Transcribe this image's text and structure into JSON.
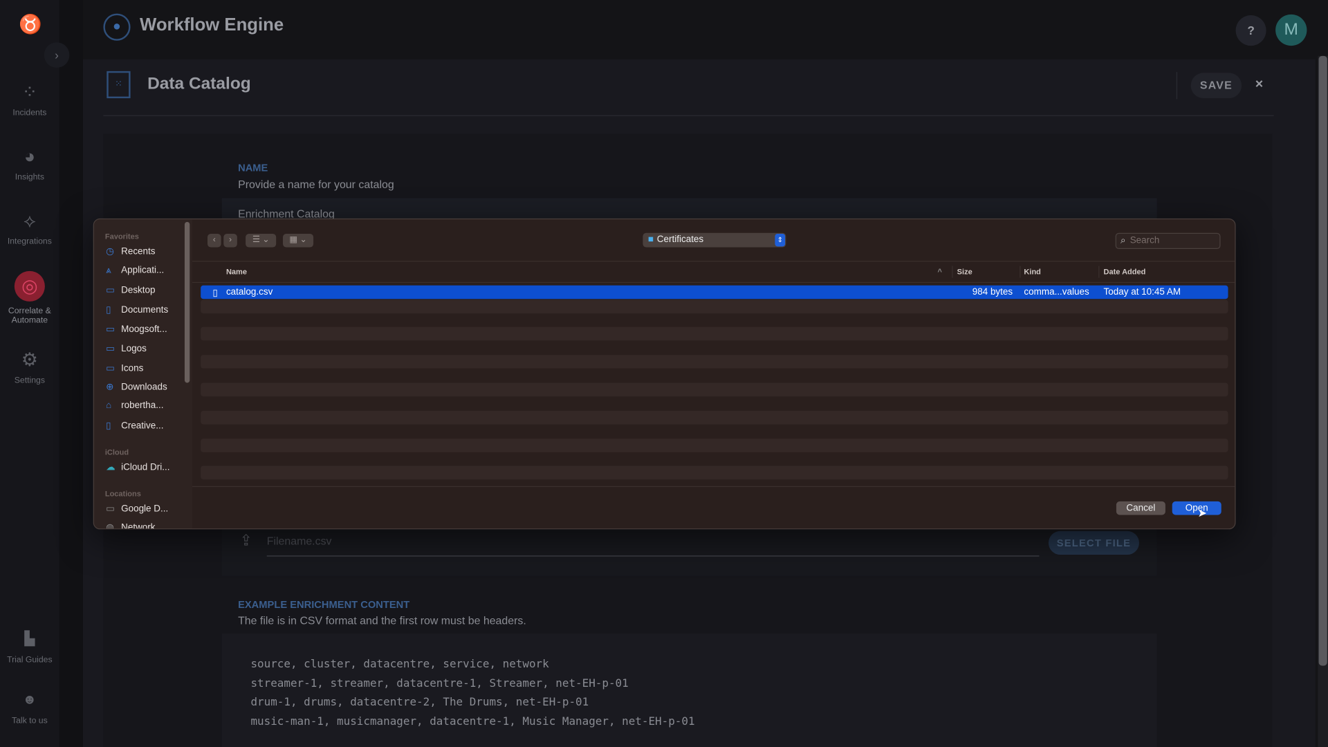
{
  "app": {
    "title": "Workflow Engine",
    "help_label": "?",
    "avatar_initial": "M"
  },
  "nav": {
    "items": [
      {
        "label": "Incidents",
        "icon": "incidents-icon"
      },
      {
        "label": "Insights",
        "icon": "pie-chart-icon"
      },
      {
        "label": "Integrations",
        "icon": "integrations-icon"
      },
      {
        "label": "Correlate & Automate",
        "icon": "radar-icon",
        "active": true
      },
      {
        "label": "Settings",
        "icon": "gear-icon"
      },
      {
        "label": "Trial Guides",
        "icon": "book-icon"
      },
      {
        "label": "Talk to us",
        "icon": "support-icon"
      }
    ],
    "accent": "#c0283a"
  },
  "page": {
    "title": "Data Catalog",
    "save_label": "SAVE",
    "close_label": "×"
  },
  "form": {
    "name_label": "NAME",
    "name_hint": "Provide a name for your catalog",
    "name_value": "Enrichment Catalog",
    "file_placeholder": "Filename.csv",
    "select_file_label": "SELECT FILE",
    "example_label": "EXAMPLE ENRICHMENT CONTENT",
    "example_hint": "The file is in CSV format and the first row must be headers.",
    "example_lines": [
      "source, cluster, datacentre, service, network",
      "streamer-1, streamer, datacentre-1, Streamer, net-EH-p-01",
      "drum-1, drums, datacentre-2, The Drums, net-EH-p-01",
      "music-man-1, musicmanager, datacentre-1, Music Manager, net-EH-p-01"
    ]
  },
  "dialog": {
    "favorites_label": "Favorites",
    "favorites": [
      "Recents",
      "Applicati...",
      "Desktop",
      "Documents",
      "Moogsoft...",
      "Logos",
      "Icons",
      "Downloads",
      "robertha...",
      "Creative..."
    ],
    "icloud_label": "iCloud",
    "icloud": [
      "iCloud Dri..."
    ],
    "locations_label": "Locations",
    "locations": [
      "Google D...",
      "Network"
    ],
    "location": "Certificates",
    "search_placeholder": "Search",
    "columns": {
      "name": "Name",
      "size": "Size",
      "kind": "Kind",
      "date": "Date Added"
    },
    "files": [
      {
        "name": "catalog.csv",
        "size": "984 bytes",
        "kind": "comma...values",
        "date": "Today at 10:45 AM",
        "selected": true
      }
    ],
    "cancel_label": "Cancel",
    "open_label": "Open",
    "accent": "#1f5fd8"
  }
}
